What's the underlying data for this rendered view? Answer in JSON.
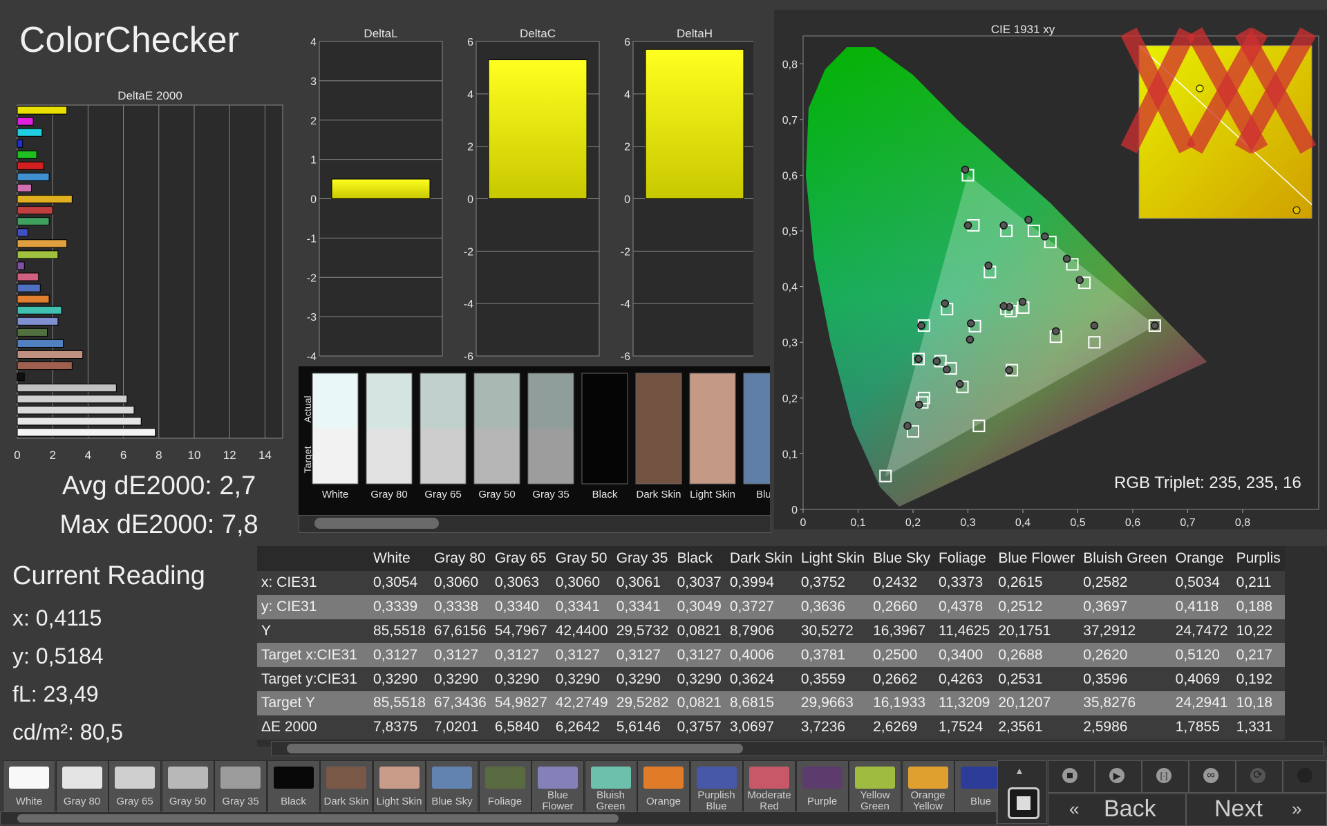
{
  "title": "ColorChecker",
  "stats": {
    "avg": "Avg dE2000: 2,7",
    "max": "Max dE2000: 7,8"
  },
  "current_reading": {
    "heading": "Current Reading",
    "x": "x: 0,4115",
    "y": "y: 0,5184",
    "fl": "fL: 23,49",
    "cdm2": "cd/m²: 80,5"
  },
  "rgb_triplet": "RGB Triplet: 235, 235, 16",
  "colors": {
    "accent": "#ffff00",
    "panel": "#2e2e2e",
    "background": "#3a3a3a"
  },
  "chart_data": [
    {
      "type": "bar",
      "orientation": "horizontal",
      "title": "DeltaE 2000",
      "xlim": [
        0,
        15
      ],
      "xticks": [
        "0",
        "2",
        "4",
        "6",
        "8",
        "10",
        "12",
        "14"
      ],
      "values": [
        2.8,
        0.9,
        1.4,
        0.3,
        1.1,
        1.5,
        1.8,
        0.8,
        3.1,
        2.0,
        1.8,
        0.6,
        2.8,
        2.3,
        0.4,
        1.2,
        1.3,
        1.8,
        2.5,
        2.3,
        1.7,
        2.6,
        3.7,
        3.1,
        0.4,
        5.6,
        6.2,
        6.6,
        7.0,
        7.8
      ],
      "bar_colors": [
        "#e8e000",
        "#e020e0",
        "#20d0e0",
        "#2030d0",
        "#20c020",
        "#d02020",
        "#4090d0",
        "#d070b0",
        "#e0b020",
        "#c04040",
        "#40a060",
        "#4050c0",
        "#e0a040",
        "#a0c040",
        "#8050a0",
        "#d06080",
        "#5070c0",
        "#e08030",
        "#40c0b0",
        "#8090d0",
        "#507040",
        "#5080c0",
        "#c09080",
        "#a06050",
        "#101010",
        "#c0c0c0",
        "#d0d0d0",
        "#dadada",
        "#e6e6e6",
        "#f4f4f4"
      ]
    },
    {
      "type": "bar",
      "title": "DeltaL",
      "ylim": [
        -4,
        4
      ],
      "yticks": [
        "4",
        "3",
        "2",
        "1",
        "0",
        "-1",
        "-2",
        "-3",
        "-4"
      ],
      "values": [
        0.5
      ]
    },
    {
      "type": "bar",
      "title": "DeltaC",
      "ylim": [
        -6,
        6
      ],
      "yticks": [
        "6",
        "4",
        "2",
        "0",
        "-2",
        "-4",
        "-6"
      ],
      "values": [
        5.3
      ]
    },
    {
      "type": "bar",
      "title": "DeltaH",
      "ylim": [
        -6,
        6
      ],
      "yticks": [
        "6",
        "4",
        "2",
        "0",
        "-2",
        "-4",
        "-6"
      ],
      "values": [
        5.7
      ]
    },
    {
      "type": "scatter",
      "title": "CIE 1931 xy",
      "xlim": [
        0,
        0.8
      ],
      "ylim": [
        0,
        0.85
      ],
      "xticks": [
        "0",
        "0,1",
        "0,2",
        "0,3",
        "0,4",
        "0,5",
        "0,6",
        "0,7",
        "0,8"
      ],
      "yticks": [
        "0",
        "0,1",
        "0,2",
        "0,3",
        "0,4",
        "0,5",
        "0,6",
        "0,7",
        "0,8"
      ],
      "gamut": [
        [
          0.64,
          0.33
        ],
        [
          0.3,
          0.6
        ],
        [
          0.15,
          0.06
        ]
      ],
      "targets": [
        [
          0.3127,
          0.329
        ],
        [
          0.4006,
          0.3624
        ],
        [
          0.3781,
          0.3559
        ],
        [
          0.25,
          0.2662
        ],
        [
          0.34,
          0.4263
        ],
        [
          0.2688,
          0.2531
        ],
        [
          0.262,
          0.3596
        ],
        [
          0.512,
          0.4069
        ],
        [
          0.217,
          0.192
        ],
        [
          0.46,
          0.31
        ],
        [
          0.3,
          0.6
        ],
        [
          0.31,
          0.51
        ],
        [
          0.37,
          0.5
        ],
        [
          0.53,
          0.3
        ],
        [
          0.42,
          0.5
        ],
        [
          0.45,
          0.48
        ],
        [
          0.49,
          0.44
        ],
        [
          0.15,
          0.06
        ],
        [
          0.2,
          0.14
        ],
        [
          0.22,
          0.2
        ],
        [
          0.64,
          0.33
        ],
        [
          0.22,
          0.33
        ],
        [
          0.38,
          0.25
        ],
        [
          0.32,
          0.15
        ],
        [
          0.21,
          0.27
        ],
        [
          0.29,
          0.22
        ],
        [
          0.37,
          0.36
        ]
      ],
      "measured": [
        [
          0.3054,
          0.3339
        ],
        [
          0.3037,
          0.3049
        ],
        [
          0.3994,
          0.3727
        ],
        [
          0.3752,
          0.3636
        ],
        [
          0.2432,
          0.266
        ],
        [
          0.3373,
          0.4378
        ],
        [
          0.2615,
          0.2512
        ],
        [
          0.2582,
          0.3697
        ],
        [
          0.5034,
          0.4118
        ],
        [
          0.211,
          0.188
        ],
        [
          0.46,
          0.32
        ],
        [
          0.295,
          0.61
        ],
        [
          0.3,
          0.51
        ],
        [
          0.365,
          0.51
        ],
        [
          0.53,
          0.33
        ],
        [
          0.41,
          0.52
        ],
        [
          0.44,
          0.49
        ],
        [
          0.48,
          0.45
        ],
        [
          0.19,
          0.15
        ],
        [
          0.21,
          0.27
        ],
        [
          0.64,
          0.33
        ],
        [
          0.215,
          0.33
        ],
        [
          0.375,
          0.25
        ],
        [
          0.285,
          0.225
        ],
        [
          0.365,
          0.365
        ]
      ],
      "inset_measured": [
        [
          0.4115,
          0.5184
        ]
      ]
    }
  ],
  "swatch_strip": {
    "row_labels": [
      "Actual",
      "Target"
    ],
    "items": [
      {
        "label": "White",
        "actual": "#e9f7f6",
        "target": "#f2f2f2"
      },
      {
        "label": "Gray 80",
        "actual": "#d4e4e0",
        "target": "#e2e2e2"
      },
      {
        "label": "Gray 65",
        "actual": "#c0d0cc",
        "target": "#cdcdcd"
      },
      {
        "label": "Gray 50",
        "actual": "#aab8b4",
        "target": "#b6b6b6"
      },
      {
        "label": "Gray 35",
        "actual": "#8f9e9b",
        "target": "#9d9d9d"
      },
      {
        "label": "Black",
        "actual": "#050505",
        "target": "#050505"
      },
      {
        "label": "Dark Skin",
        "actual": "#735342",
        "target": "#735342"
      },
      {
        "label": "Light Skin",
        "actual": "#c49a84",
        "target": "#c49a84"
      },
      {
        "label": "Blue",
        "actual": "#5f7fa8",
        "target": "#5f7fa8"
      }
    ]
  },
  "table": {
    "columns": [
      "White",
      "Gray 80",
      "Gray 65",
      "Gray 50",
      "Gray 35",
      "Black",
      "Dark Skin",
      "Light Skin",
      "Blue Sky",
      "Foliage",
      "Blue Flower",
      "Bluish Green",
      "Orange",
      "Purplis"
    ],
    "rows": [
      {
        "label": "x: CIE31",
        "values": [
          "0,3054",
          "0,3060",
          "0,3063",
          "0,3060",
          "0,3061",
          "0,3037",
          "0,3994",
          "0,3752",
          "0,2432",
          "0,3373",
          "0,2615",
          "0,2582",
          "0,5034",
          "0,211"
        ]
      },
      {
        "label": "y: CIE31",
        "values": [
          "0,3339",
          "0,3338",
          "0,3340",
          "0,3341",
          "0,3341",
          "0,3049",
          "0,3727",
          "0,3636",
          "0,2660",
          "0,4378",
          "0,2512",
          "0,3697",
          "0,4118",
          "0,188"
        ]
      },
      {
        "label": "Y",
        "values": [
          "85,5518",
          "67,6156",
          "54,7967",
          "42,4400",
          "29,5732",
          "0,0821",
          "8,7906",
          "30,5272",
          "16,3967",
          "11,4625",
          "20,1751",
          "37,2912",
          "24,7472",
          "10,22"
        ]
      },
      {
        "label": "Target x:CIE31",
        "values": [
          "0,3127",
          "0,3127",
          "0,3127",
          "0,3127",
          "0,3127",
          "0,3127",
          "0,4006",
          "0,3781",
          "0,2500",
          "0,3400",
          "0,2688",
          "0,2620",
          "0,5120",
          "0,217"
        ]
      },
      {
        "label": "Target y:CIE31",
        "values": [
          "0,3290",
          "0,3290",
          "0,3290",
          "0,3290",
          "0,3290",
          "0,3290",
          "0,3624",
          "0,3559",
          "0,2662",
          "0,4263",
          "0,2531",
          "0,3596",
          "0,4069",
          "0,192"
        ]
      },
      {
        "label": "Target Y",
        "values": [
          "85,5518",
          "67,3436",
          "54,9827",
          "42,2749",
          "29,5282",
          "0,0821",
          "8,6815",
          "29,9663",
          "16,1933",
          "11,3209",
          "20,1207",
          "35,8276",
          "24,2941",
          "10,18"
        ]
      },
      {
        "label": "ΔE 2000",
        "values": [
          "7,8375",
          "7,0201",
          "6,5840",
          "6,2642",
          "5,6146",
          "0,3757",
          "3,0697",
          "3,7236",
          "2,6269",
          "1,7524",
          "2,3561",
          "2,5986",
          "1,7855",
          "1,331"
        ]
      }
    ]
  },
  "bottom_swatches": [
    {
      "label": "White",
      "color": "#f8f8f8"
    },
    {
      "label": "Gray 80",
      "color": "#e4e4e4"
    },
    {
      "label": "Gray 65",
      "color": "#cfcfcf"
    },
    {
      "label": "Gray 50",
      "color": "#b8b8b8"
    },
    {
      "label": "Gray 35",
      "color": "#9c9c9c"
    },
    {
      "label": "Black",
      "color": "#080808"
    },
    {
      "label": "Dark Skin",
      "color": "#7a5848"
    },
    {
      "label": "Light Skin",
      "color": "#c89c88"
    },
    {
      "label": "Blue Sky",
      "color": "#6282b0"
    },
    {
      "label": "Foliage",
      "color": "#5a6a40"
    },
    {
      "label": "Blue Flower",
      "color": "#8480b8"
    },
    {
      "label": "Bluish Green",
      "color": "#6cc0ac"
    },
    {
      "label": "Orange",
      "color": "#e07c28"
    },
    {
      "label": "Purplish Blue",
      "color": "#4858a8"
    },
    {
      "label": "Moderate Red",
      "color": "#c85868"
    },
    {
      "label": "Purple",
      "color": "#5c3c6c"
    },
    {
      "label": "Yellow Green",
      "color": "#a0bc40"
    },
    {
      "label": "Orange Yellow",
      "color": "#e0a030"
    },
    {
      "label": "Blue",
      "color": "#2c3c98"
    }
  ],
  "controls": {
    "back": "Back",
    "next": "Next"
  },
  "icons": [
    "stop-icon",
    "play-icon",
    "fit-icon",
    "loop-icon",
    "refresh-icon",
    "record-icon",
    "scroll-up-icon",
    "back-chevrons-icon",
    "next-chevrons-icon"
  ]
}
